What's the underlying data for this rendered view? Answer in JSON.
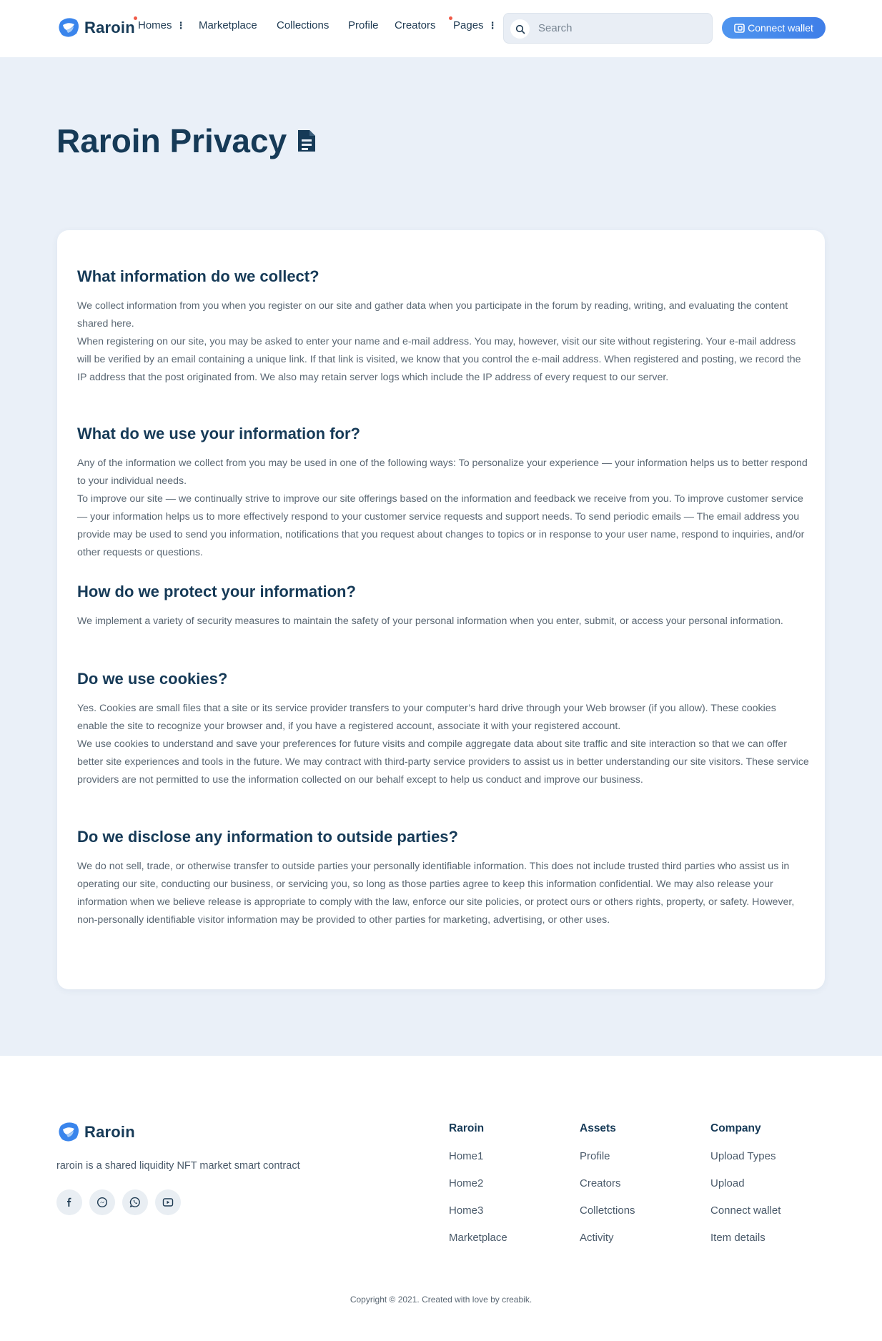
{
  "header": {
    "brand": "Raroin",
    "nav": [
      {
        "label": "Homes",
        "has_menu": true,
        "dot": true
      },
      {
        "label": "Marketplace",
        "has_menu": false,
        "dot": false
      },
      {
        "label": "Collections",
        "has_menu": false,
        "dot": false
      },
      {
        "label": "Profile",
        "has_menu": false,
        "dot": false
      },
      {
        "label": "Creators",
        "has_menu": false,
        "dot": false
      },
      {
        "label": "Pages",
        "has_menu": true,
        "dot": true
      }
    ],
    "search_placeholder": "Search",
    "wallet_label": "Connect wallet",
    "accent": "#4a8ded",
    "dot_color": "#f05a48"
  },
  "page": {
    "title": "Raroin Privacy",
    "title_icon": "document-icon"
  },
  "sections": [
    {
      "heading": "What information do we collect?",
      "body": "We collect information from you when you register on our site and gather data when you participate in the forum by reading, writing, and evaluating the content shared here.\nWhen registering on our site, you may be asked to enter your name and e-mail address. You may, however, visit our site without registering. Your e-mail address will be verified by an email containing a unique link. If that link is visited, we know that you control the e-mail address. When registered and posting, we record the IP address that the post originated from. We also may retain server logs which include the IP address of every request to our server."
    },
    {
      "heading": "What do we use your information for?",
      "body": "Any of the information we collect from you may be used in one of the following ways: To personalize your experience — your information helps us to better respond to your individual needs.\nTo improve our site — we continually strive to improve our site offerings based on the information and feedback we receive from you. To improve customer service — your information helps us to more effectively respond to your customer service requests and support needs. To send periodic emails — The email address you provide may be used to send you information, notifications that you request about changes to topics or in response to your user name, respond to inquiries, and/or other requests or questions."
    },
    {
      "heading": "How do we protect your information?",
      "body": "We implement a variety of security measures to maintain the safety of your personal information when you enter, submit, or access your personal information."
    },
    {
      "heading": "Do we use cookies?",
      "body": "Yes. Cookies are small files that a site or its service provider transfers to your computer’s hard drive through your Web browser (if you allow). These cookies enable the site to recognize your browser and, if you have a registered account, associate it with your registered account.\nWe use cookies to understand and save your preferences for future visits and compile aggregate data about site traffic and site interaction so that we can offer better site experiences and tools in the future. We may contract with third-party service providers to assist us in better understanding our site visitors. These service providers are not permitted to use the information collected on our behalf except to help us conduct and improve our business."
    },
    {
      "heading": "Do we disclose any information to outside parties?",
      "body": "We do not sell, trade, or otherwise transfer to outside parties your personally identifiable information. This does not include trusted third parties who assist us in operating our site, conducting our business, or servicing you, so long as those parties agree to keep this information confidential. We may also release your information when we believe release is appropriate to comply with the law, enforce our site policies, or protect ours or others rights, property, or safety. However, non-personally identifiable visitor information may be provided to other parties for marketing, advertising, or other uses."
    }
  ],
  "footer": {
    "brand": "Raroin",
    "tagline": "raroin is a shared liquidity NFT market smart contract",
    "socials": [
      "facebook-icon",
      "messenger-icon",
      "whatsapp-icon",
      "youtube-icon"
    ],
    "columns": [
      {
        "title": "Raroin",
        "links": [
          "Home1",
          "Home2",
          "Home3",
          "Marketplace"
        ]
      },
      {
        "title": "Assets",
        "links": [
          "Profile",
          "Creators",
          "Colletctions",
          "Activity"
        ]
      },
      {
        "title": "Company",
        "links": [
          "Upload Types",
          "Upload",
          "Connect wallet",
          "Item details"
        ]
      }
    ],
    "copyright": "Copyright © 2021. Created with love by creabik."
  }
}
